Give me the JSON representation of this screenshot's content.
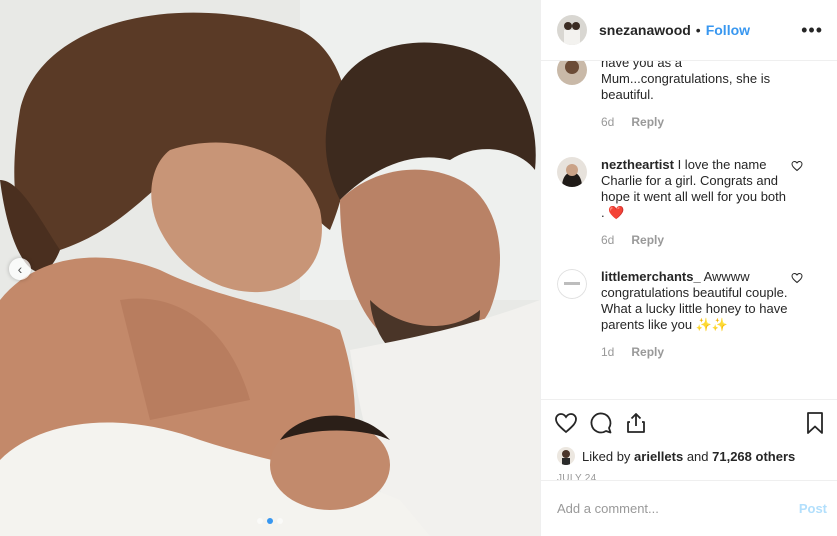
{
  "photo": {
    "description_icon": "carousel-photo",
    "carousel_prev_icon": "chevron-left-icon",
    "dots": 3,
    "active_dot": 1
  },
  "header": {
    "username": "snezanawood",
    "separator": "•",
    "follow_label": "Follow",
    "more_icon": "more-options-icon",
    "more_glyph": "•••"
  },
  "comments": [
    {
      "username": "",
      "text": "have you as a Mum...congratulations, she is beautiful.",
      "time": "6d",
      "reply": "Reply"
    },
    {
      "username": "neztheartist",
      "text": " I love the name Charlie for a girl. Congrats and hope it went all well for you both . ❤️",
      "time": "6d",
      "reply": "Reply"
    },
    {
      "username": "littlemerchants_",
      "text": " Awwww congratulations beautiful couple. What a lucky little honey to have parents like you ✨✨",
      "time": "1d",
      "reply": "Reply"
    }
  ],
  "likes": {
    "prefix": "Liked by ",
    "user": "ariellets",
    "middle": " and ",
    "count": "71,268 others"
  },
  "date": "JULY 24",
  "add_comment": {
    "placeholder": "Add a comment...",
    "post_label": "Post"
  },
  "colors": {
    "accent": "#3897f0",
    "muted": "#999999",
    "post_disabled": "#b2dffc",
    "border": "#efefef"
  }
}
